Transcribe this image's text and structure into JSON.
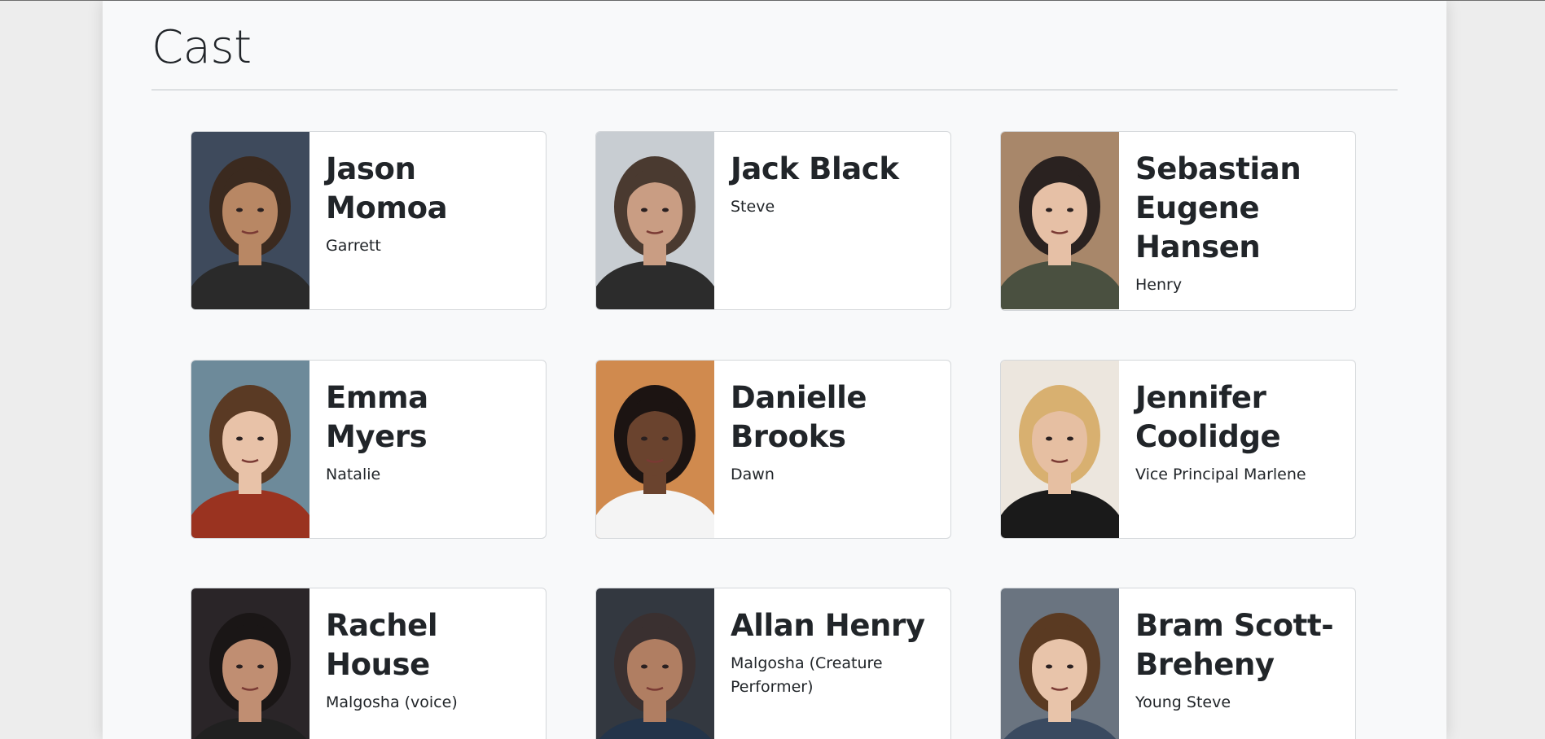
{
  "page": {
    "title": "Cast"
  },
  "cast": [
    {
      "name": "Jason Momoa",
      "role": "Garrett",
      "bg": "#3e4a5c",
      "skin": "#b88764",
      "hair": "#3b2a1f",
      "shirt": "#2a2a2a"
    },
    {
      "name": "Jack Black",
      "role": "Steve",
      "bg": "#c8cdd2",
      "skin": "#c99d83",
      "hair": "#4a3a30",
      "shirt": "#2c2c2c"
    },
    {
      "name": "Sebastian Eugene Hansen",
      "role": "Henry",
      "bg": "#a8876a",
      "skin": "#e6c0a6",
      "hair": "#2a2220",
      "shirt": "#4a5040"
    },
    {
      "name": "Emma Myers",
      "role": "Natalie",
      "bg": "#6d8a9a",
      "skin": "#e8c2a8",
      "hair": "#5a3a24",
      "shirt": "#9a3320"
    },
    {
      "name": "Danielle Brooks",
      "role": "Dawn",
      "bg": "#d08a4e",
      "skin": "#6a432e",
      "hair": "#1c1412",
      "shirt": "#f4f4f4"
    },
    {
      "name": "Jennifer Coolidge",
      "role": "Vice Principal Marlene",
      "bg": "#ece6de",
      "skin": "#e6bfa2",
      "hair": "#d8b070",
      "shirt": "#1a1a1a"
    },
    {
      "name": "Rachel House",
      "role": "Malgosha (voice)",
      "bg": "#2a2528",
      "skin": "#c08e72",
      "hair": "#1a1616",
      "shirt": "#202020"
    },
    {
      "name": "Allan Henry",
      "role": "Malgosha (Creature Performer)",
      "bg": "#333840",
      "skin": "#b07e62",
      "hair": "#3a3030",
      "shirt": "#23344a"
    },
    {
      "name": "Bram Scott-Breheny",
      "role": "Young Steve",
      "bg": "#6a7480",
      "skin": "#e8c4aa",
      "hair": "#5a3a22",
      "shirt": "#3a4a60"
    }
  ]
}
